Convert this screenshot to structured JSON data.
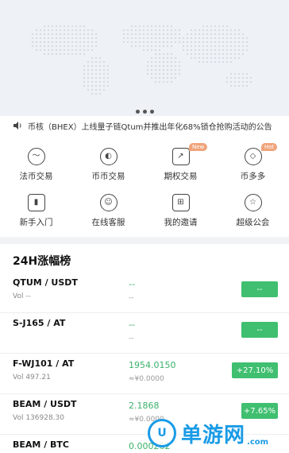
{
  "banner": {
    "dot_count": 3
  },
  "notice": {
    "icon": "speaker-icon",
    "text": "币核（BHEX）上线量子链Qtum并推出年化68%锁仓抢购活动的公告"
  },
  "menu": [
    {
      "label": "法币交易",
      "icon": "fiat-trade-icon",
      "glyph": "〜"
    },
    {
      "label": "币币交易",
      "icon": "coin-trade-icon",
      "glyph": "◐"
    },
    {
      "label": "期权交易",
      "icon": "options-trade-icon",
      "glyph": "↗",
      "badge": "New"
    },
    {
      "label": "币多多",
      "icon": "coin-earn-icon",
      "glyph": "◇",
      "badge": "Hot"
    },
    {
      "label": "新手入门",
      "icon": "beginner-book-icon",
      "glyph": "▮"
    },
    {
      "label": "在线客服",
      "icon": "customer-service-icon",
      "glyph": "☺"
    },
    {
      "label": "我的邀请",
      "icon": "gift-icon",
      "glyph": "⊞"
    },
    {
      "label": "超级公会",
      "icon": "super-guild-icon",
      "glyph": "☆"
    }
  ],
  "ranking": {
    "title": "24H涨幅榜",
    "rows": [
      {
        "pair": "QTUM / USDT",
        "vol": "Vol  --",
        "price": "--",
        "cny": "--",
        "change": "--"
      },
      {
        "pair": "S-J165 / AT",
        "vol": "",
        "price": "--",
        "cny": "--",
        "change": "--"
      },
      {
        "pair": "F-WJ101 / AT",
        "vol": "Vol  497.21",
        "price": "1954.0150",
        "cny": "≈¥0.0000",
        "change": "+27.10%"
      },
      {
        "pair": "BEAM / USDT",
        "vol": "Vol  136928.30",
        "price": "2.1868",
        "cny": "≈¥0.0000",
        "change": "+7.65%"
      },
      {
        "pair": "BEAM / BTC",
        "vol": "",
        "price": "0.000262",
        "cny": "",
        "change": ""
      }
    ]
  },
  "watermark": {
    "logo": "U",
    "text": "单游网",
    "domain": ".com"
  },
  "colors": {
    "up": "#3fbf6f",
    "price": "#3bb26a",
    "brand": "#1a9be6"
  }
}
